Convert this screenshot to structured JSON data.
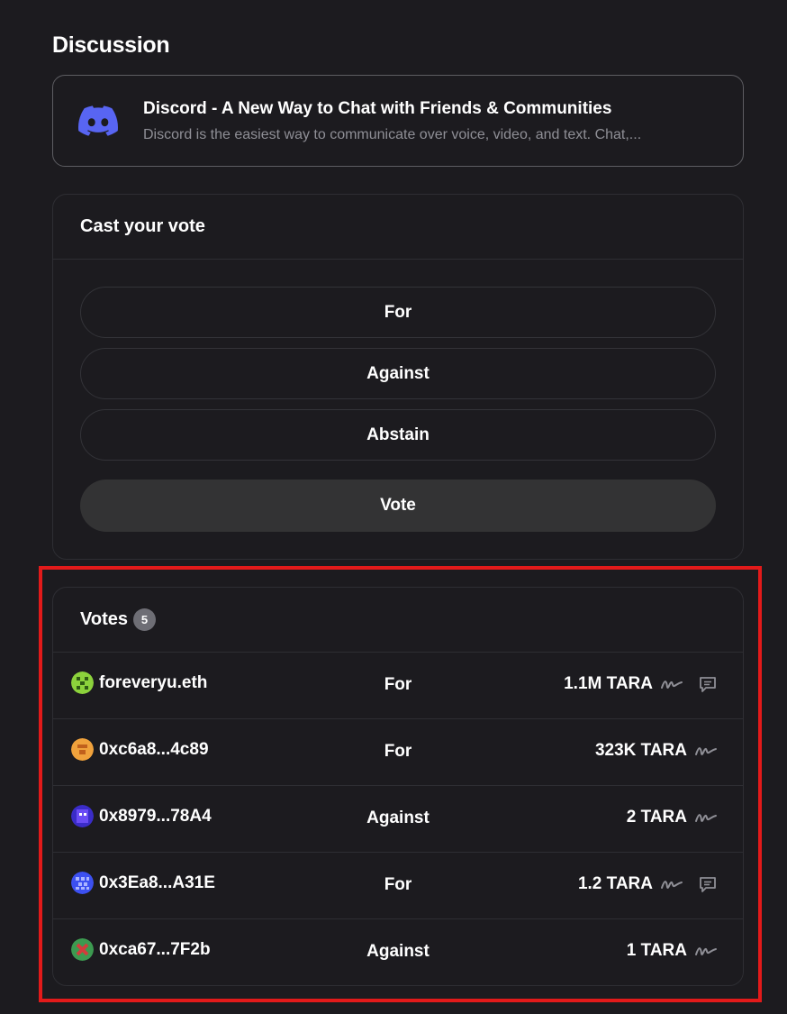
{
  "discussion": {
    "title": "Discussion",
    "link": {
      "title": "Discord - A New Way to Chat with Friends & Communities",
      "description": "Discord is the easiest way to communicate over voice, video, and text. Chat,...",
      "icon": "discord-logo-icon",
      "color": "#5865f2"
    }
  },
  "cast_vote": {
    "title": "Cast your vote",
    "choices": [
      "For",
      "Against",
      "Abstain"
    ],
    "submit_label": "Vote"
  },
  "votes": {
    "title": "Votes",
    "count": "5",
    "rows": [
      {
        "voter": "foreveryu.eth",
        "choice": "For",
        "amount": "1.1M TARA",
        "has_comment": true,
        "avatar_color": "#8cd23c"
      },
      {
        "voter": "0xc6a8...4c89",
        "choice": "For",
        "amount": "323K TARA",
        "has_comment": false,
        "avatar_color": "#f0a23c"
      },
      {
        "voter": "0x8979...78A4",
        "choice": "Against",
        "amount": "2 TARA",
        "has_comment": false,
        "avatar_color": "#5a3cf0"
      },
      {
        "voter": "0x3Ea8...A31E",
        "choice": "For",
        "amount": "1.2 TARA",
        "has_comment": true,
        "avatar_color": "#3c50f0"
      },
      {
        "voter": "0xca67...7F2b",
        "choice": "Against",
        "amount": "1 TARA",
        "has_comment": false,
        "avatar_color": "#3c9a50"
      }
    ]
  },
  "highlight_color": "#e21a1a"
}
